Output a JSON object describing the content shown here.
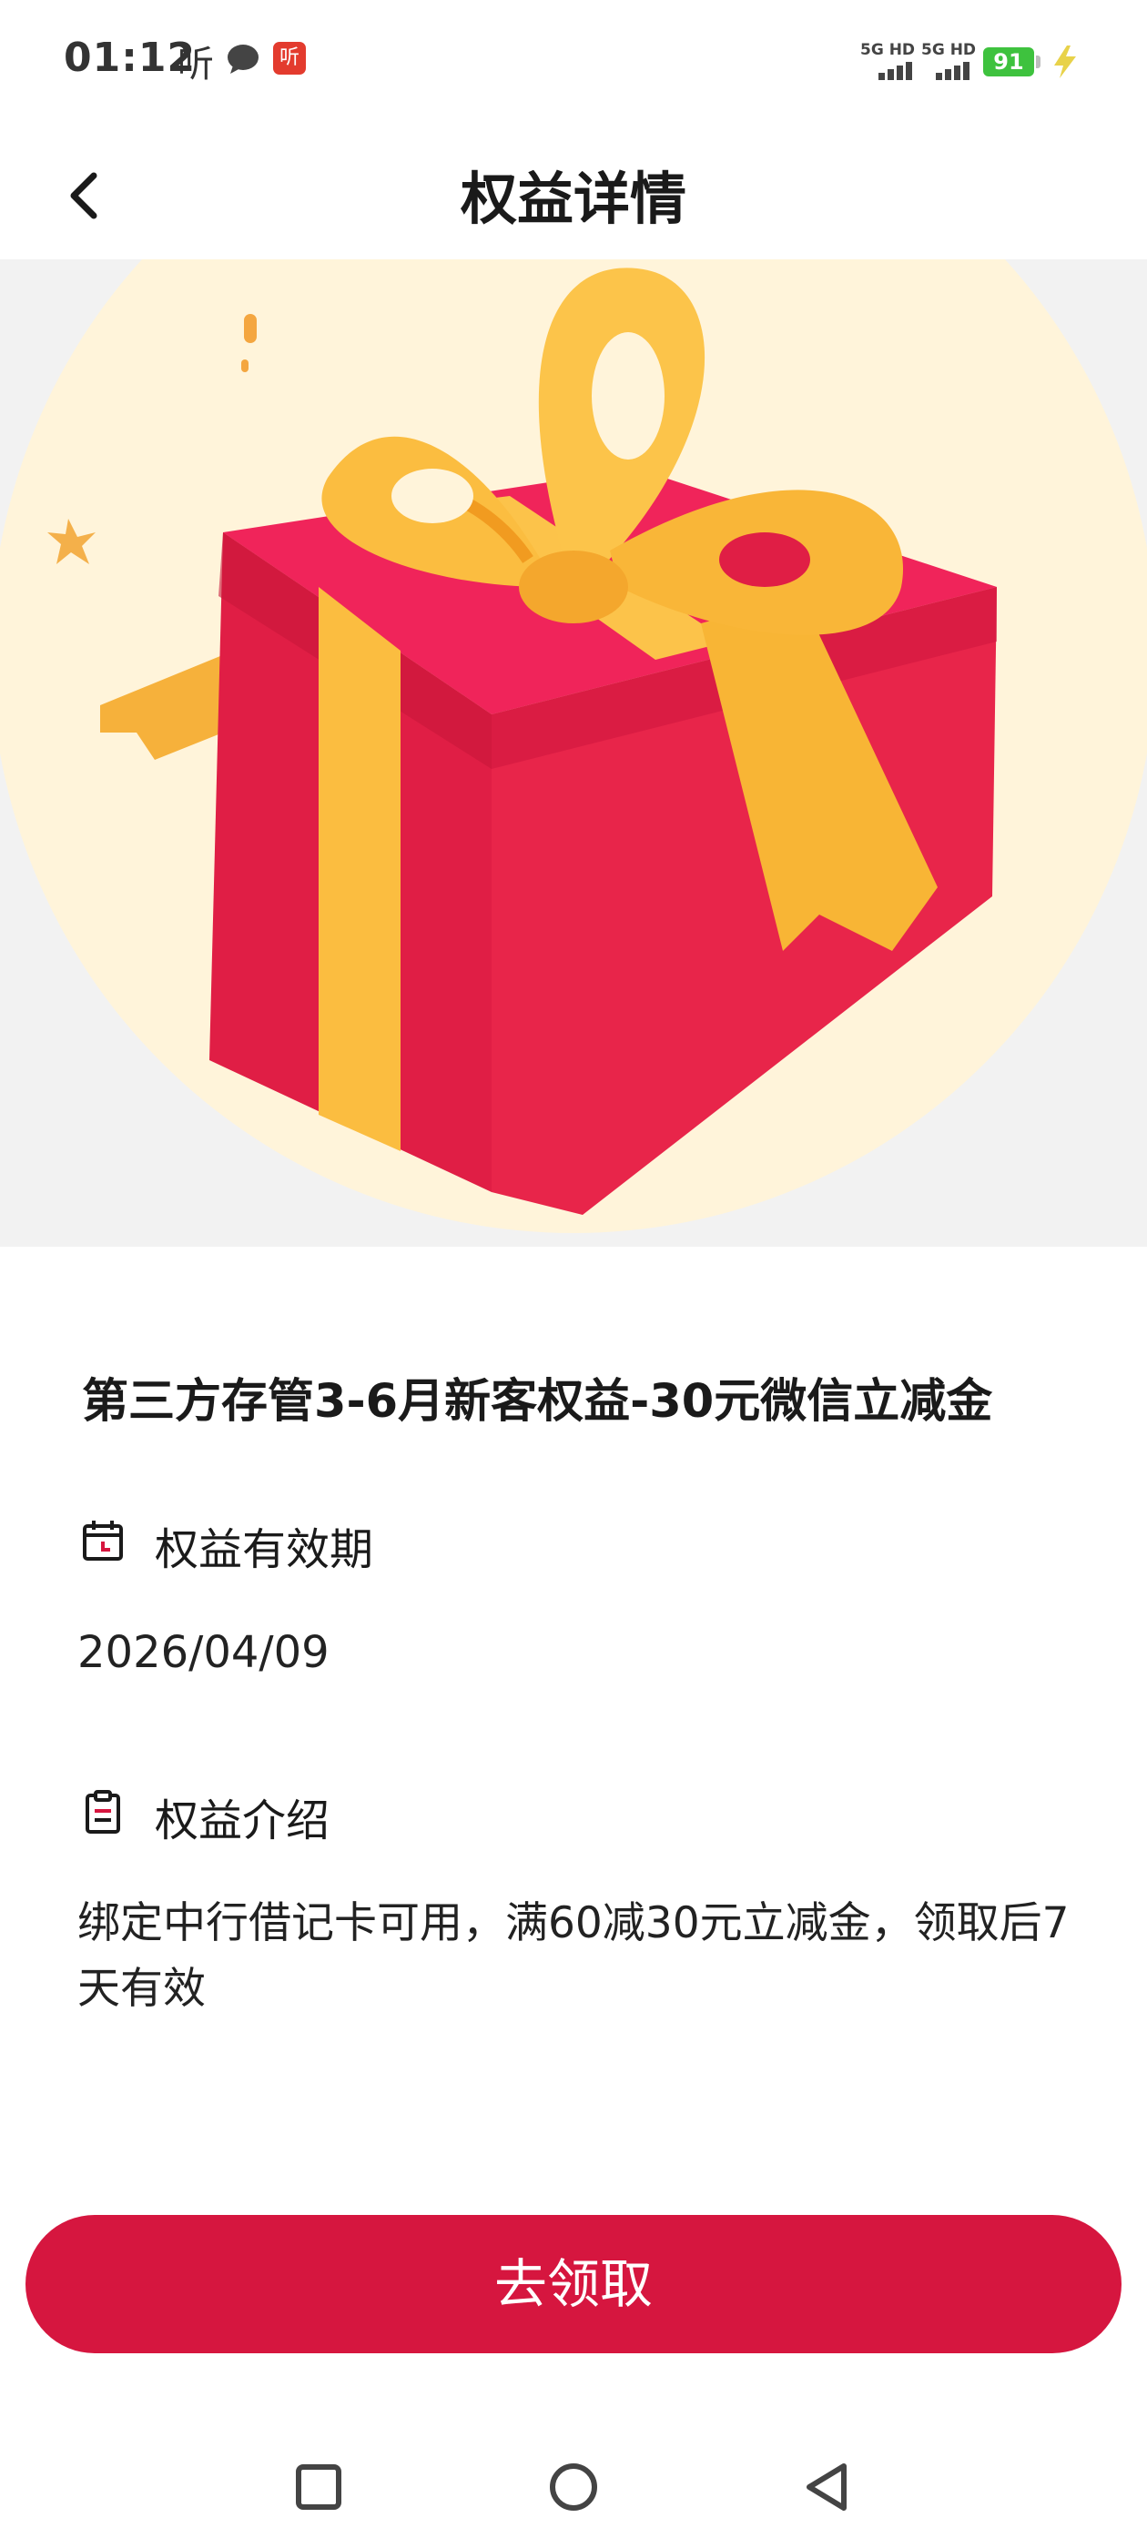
{
  "status_bar": {
    "time": "01:12",
    "ting_label": "听",
    "app_icon_label": "听",
    "net1": "5G HD",
    "net2": "5G HD",
    "battery": "91"
  },
  "header": {
    "title": "权益详情",
    "back_icon": "chevron-left-icon"
  },
  "card": {
    "title": "第三方存管3-6月新客权益-30元微信立减金",
    "validity_label": "权益有效期",
    "validity_value": "2026/04/09",
    "intro_label": "权益介绍",
    "intro_text": "绑定中行借记卡可用，满60减30元立减金，领取后7天有效"
  },
  "action": {
    "claim_label": "去领取"
  },
  "colors": {
    "accent": "#d6163f",
    "gift_red": "#e01e45",
    "ribbon": "#fbbd40",
    "background": "#f2f2f2"
  },
  "nav": {
    "icons": [
      "square-icon",
      "circle-icon",
      "triangle-back-icon"
    ]
  }
}
